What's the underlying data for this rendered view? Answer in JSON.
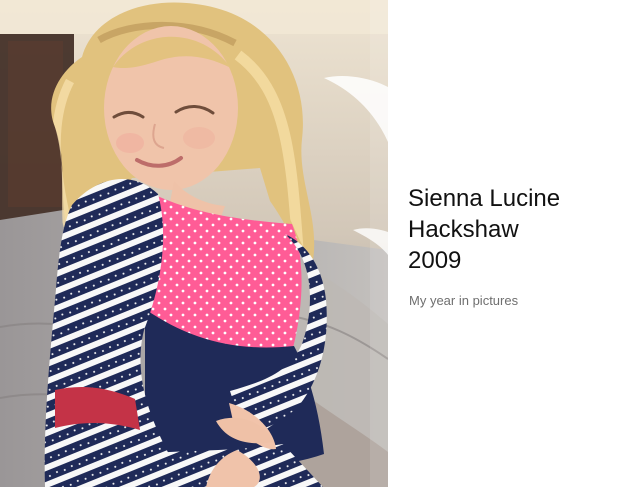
{
  "page": {
    "title_lines": [
      "Sienna Lucine",
      "Hackshaw",
      "2009"
    ],
    "subtitle": "My year in pictures"
  },
  "photo": {
    "subject": "toddler with curly blonde hair sitting on steps",
    "colors": {
      "background": "#c9c0b5",
      "wall": "#e9dfcd",
      "skin": "#f0c6ae",
      "hair": "#e3c47d",
      "navy": "#202b59",
      "pink": "#ff5c96",
      "white": "#ffffff",
      "red": "#c43347",
      "pavement": "#9d9a9a"
    }
  }
}
